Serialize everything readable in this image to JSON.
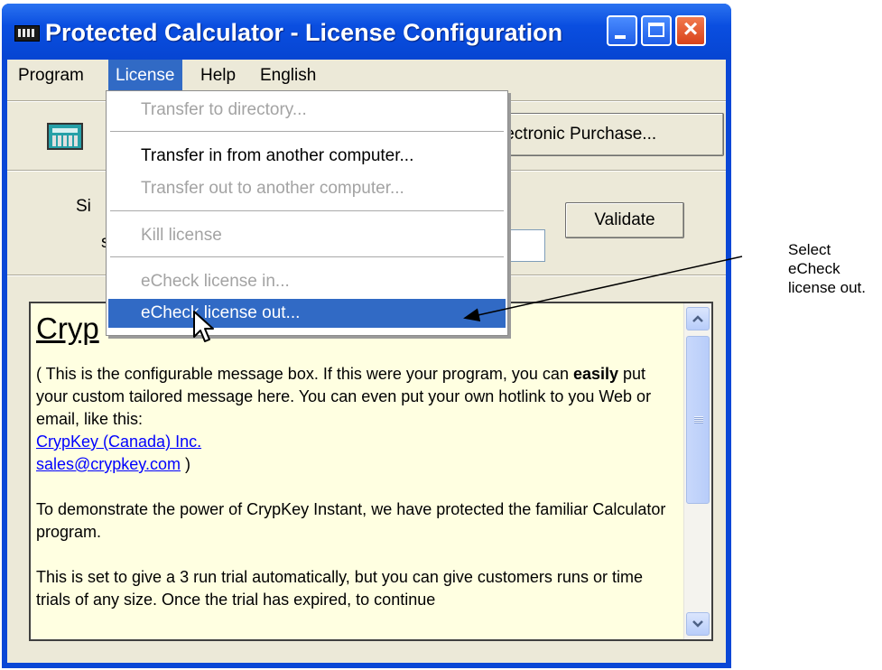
{
  "window": {
    "title": "Protected Calculator - License Configuration"
  },
  "menubar": {
    "items": [
      "Program",
      "License",
      "Help",
      "English"
    ]
  },
  "toolbar": {
    "purchase_button": "Electronic Purchase...",
    "purchase_button_visible": "lectronic Purchase...",
    "site_label_visible": "Si",
    "second_label_visible": "s",
    "validate_button": "Validate"
  },
  "license_menu": {
    "items": [
      {
        "label": "Transfer to directory...",
        "enabled": false
      },
      {
        "label": "Transfer in from another computer...",
        "enabled": true
      },
      {
        "label": "Transfer out to another computer...",
        "enabled": false
      },
      {
        "label": "Kill license",
        "enabled": false
      },
      {
        "label": "eCheck license in...",
        "enabled": false
      },
      {
        "label": "eCheck license out...",
        "enabled": true,
        "selected": true
      }
    ]
  },
  "message_box": {
    "heading_visible": "Cryp",
    "para1": "( This is the  configurable message box. If this were your program, you can ",
    "para1_bold": "easily",
    "para1_rest": " put your custom tailored message here. You can even put your own hotlink to you Web or email, like this:",
    "link_company": "CrypKey (Canada) Inc.",
    "link_email": "sales@crypkey.com",
    "link_close": " )",
    "para2": "To demonstrate the power of CrypKey Instant, we have protected the familiar Calculator program.",
    "para3": "This is set to give a 3 run trial automatically, but you can give customers runs or time trials of any size. Once the trial has expired, to continue"
  },
  "annotation": {
    "lines": [
      "Select",
      "eCheck",
      "license out."
    ]
  },
  "colors": {
    "titlebar": "#0a4ee0",
    "menu_highlight": "#316ac5",
    "message_bg": "#ffffe1",
    "link": "#0000ff"
  }
}
